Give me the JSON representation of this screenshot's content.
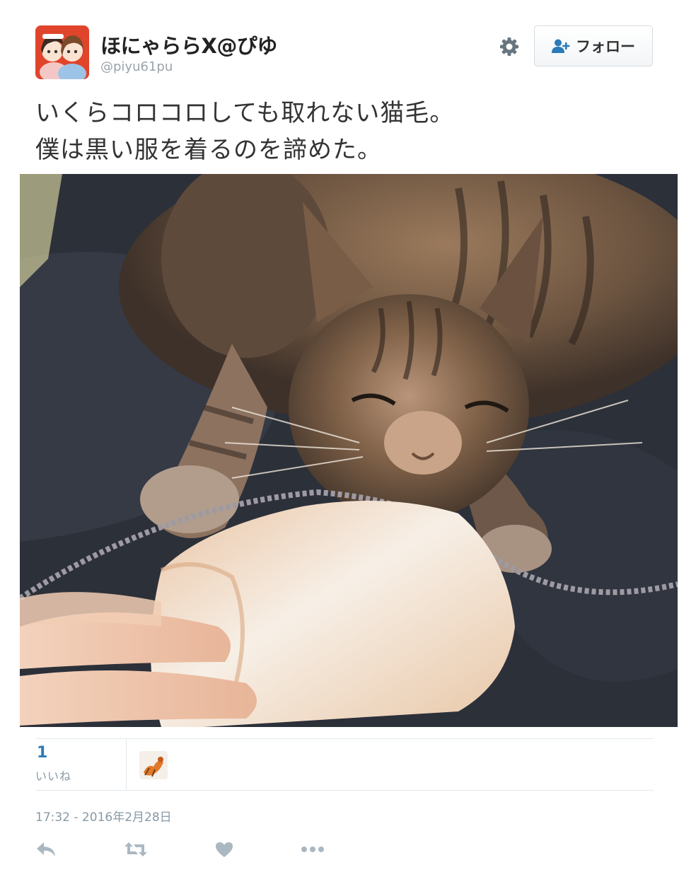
{
  "user": {
    "display_name": "ほにゃららX@ぴゆ",
    "handle": "@piyu61pu",
    "avatar_icon": "user-avatar"
  },
  "header": {
    "settings_icon": "gear-icon",
    "follow_label": "フォロー",
    "follow_icon": "add-user-icon"
  },
  "tweet": {
    "lines": [
      "いくらコロコロしても取れない猫毛。",
      "僕は黒い服を着るのを諦めた。"
    ],
    "photo": "cat-photo"
  },
  "stats": {
    "likes_count": "1",
    "likes_label": "いいね"
  },
  "timestamp": "17:32 - 2016年2月28日",
  "actions": [
    {
      "name": "reply-icon"
    },
    {
      "name": "retweet-icon"
    },
    {
      "name": "like-icon"
    },
    {
      "name": "more-icon"
    }
  ],
  "colors": {
    "link_blue": "#2b7bb9",
    "muted_text": "#8899a6",
    "action_gray": "#aab8c2",
    "divider": "#e1e8ed"
  }
}
